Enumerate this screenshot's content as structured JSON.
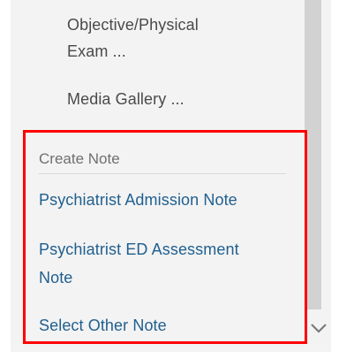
{
  "menu": {
    "items": [
      {
        "line1": "Objective/Physical",
        "line2": "Exam ..."
      },
      {
        "label": "Media Gallery ..."
      }
    ]
  },
  "create_note": {
    "header": "Create Note",
    "links": [
      {
        "label": "Psychiatrist Admission Note"
      },
      {
        "line1": "Psychiatrist ED Assessment",
        "line2": "Note"
      },
      {
        "label": "Select Other Note"
      }
    ]
  },
  "scrollbar": {
    "down_icon": "chevron-down-icon"
  },
  "colors": {
    "link": "#1f5f8f",
    "menu_text": "#4a4a4a",
    "header_text": "#6f6f6f",
    "highlight": "#ff0000",
    "panel": "#f3f3f3"
  }
}
